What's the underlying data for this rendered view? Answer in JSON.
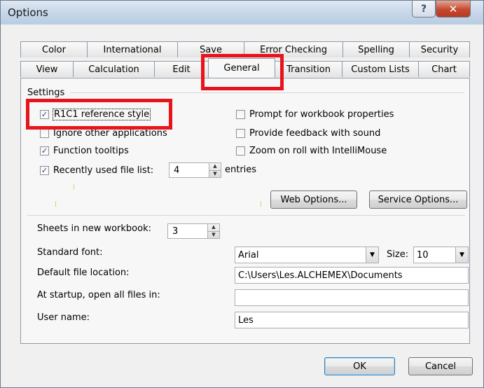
{
  "window": {
    "title": "Options",
    "help_glyph": "?",
    "close_glyph": "✕"
  },
  "tabs": {
    "row_back": [
      "Color",
      "International",
      "Save",
      "Error Checking",
      "Spelling",
      "Security"
    ],
    "row_front": [
      "View",
      "Calculation",
      "Edit",
      "General",
      "Transition",
      "Custom Lists",
      "Chart"
    ],
    "selected": "General",
    "partial_save": "S...e",
    "partial_error": "E..."
  },
  "settings": {
    "group_label": "Settings",
    "r1c1": {
      "label": "R1C1 reference style",
      "checked": true
    },
    "ignore_apps": {
      "label": "Ignore other applications",
      "checked": false
    },
    "function_tooltips": {
      "label": "Function tooltips",
      "checked": true
    },
    "recent_files": {
      "label": "Recently used file list:",
      "checked": true,
      "value": "4",
      "suffix": "entries"
    },
    "prompt_props": {
      "label": "Prompt for workbook properties",
      "checked": false
    },
    "feedback_sound": {
      "label": "Provide feedback with sound",
      "checked": false
    },
    "zoom_roll": {
      "label": "Zoom on roll with IntelliMouse",
      "checked": false
    },
    "web_options_label": "Web Options...",
    "service_options_label": "Service Options..."
  },
  "workbook": {
    "sheets_label": "Sheets in new workbook:",
    "sheets_value": "3",
    "font_label": "Standard font:",
    "font_value": "Arial",
    "size_label": "Size:",
    "size_value": "10",
    "file_location_label": "Default file location:",
    "file_location_value": "C:\\Users\\Les.ALCHEMEX\\Documents",
    "startup_label": "At startup, open all files in:",
    "startup_value": "",
    "user_name_label": "User name:",
    "user_name_value": "Les"
  },
  "footer": {
    "ok_label": "OK",
    "cancel_label": "Cancel"
  },
  "annotation": {
    "color": "#e8141c"
  }
}
